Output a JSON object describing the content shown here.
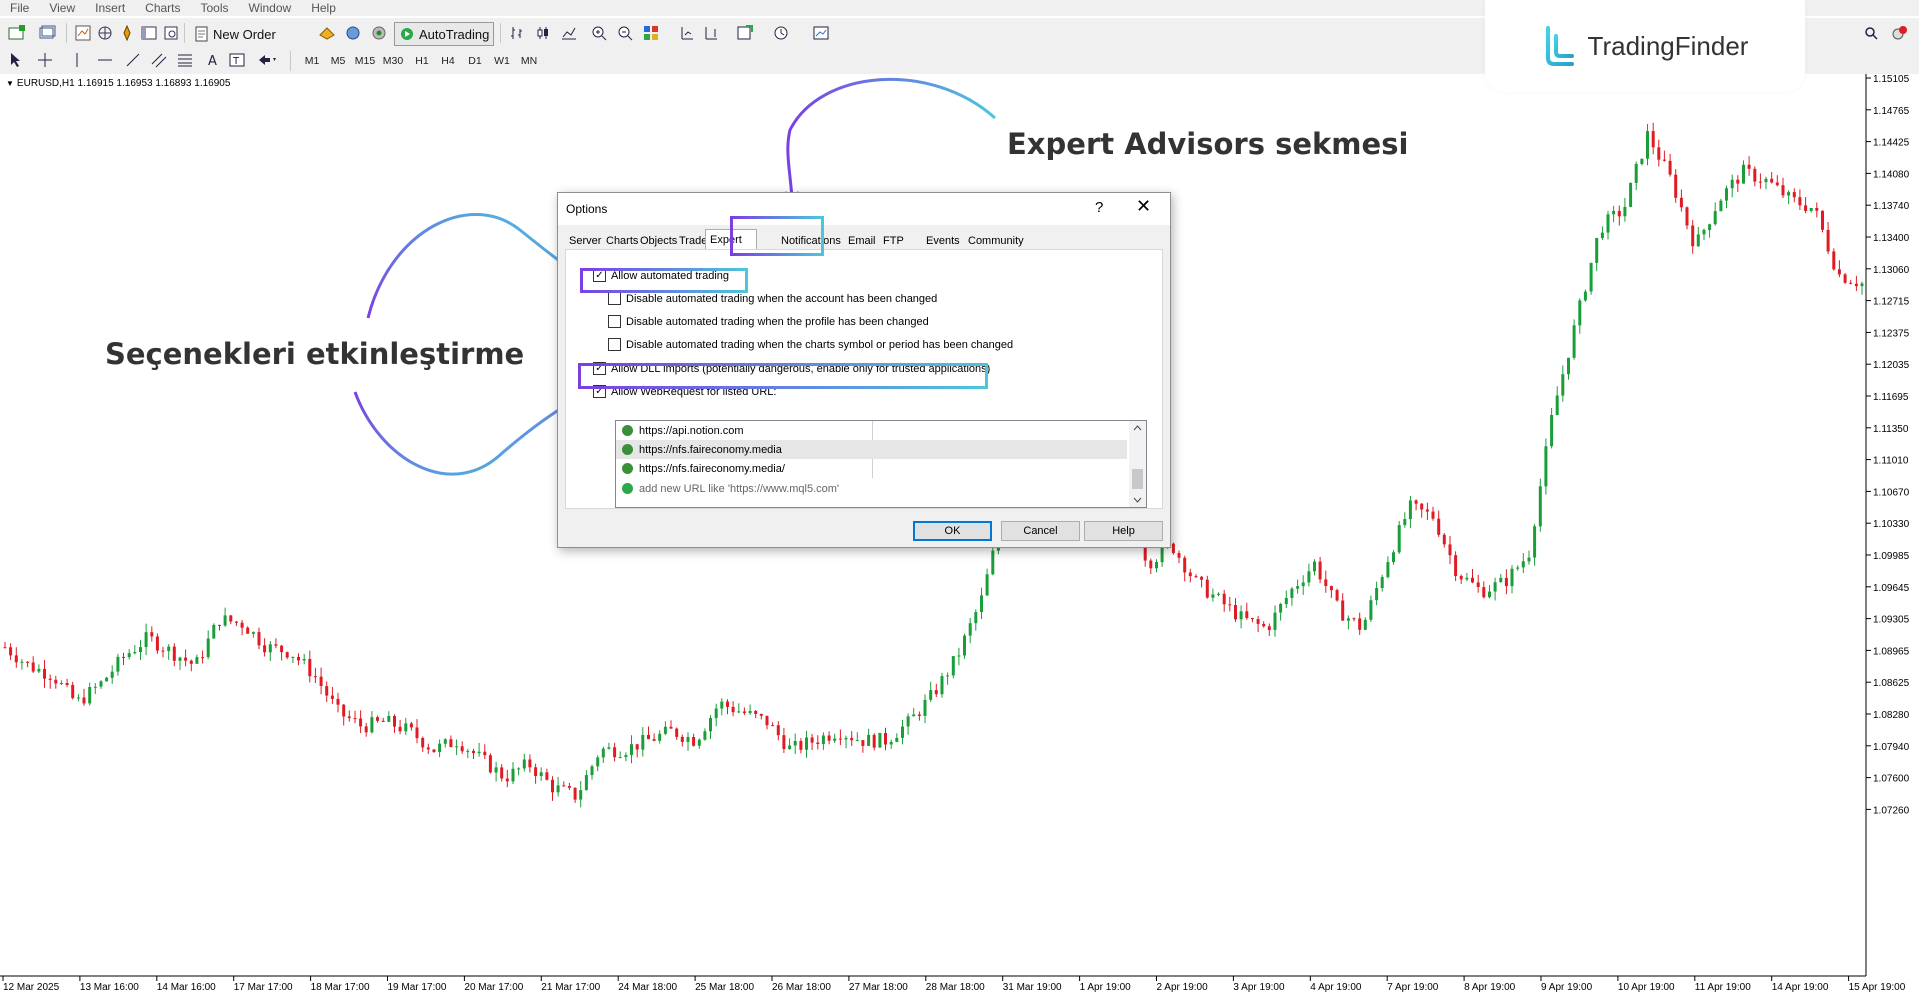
{
  "menu": [
    "File",
    "View",
    "Insert",
    "Charts",
    "Tools",
    "Window",
    "Help"
  ],
  "toolbar": {
    "new_order_label": "New Order",
    "autotrading_label": "AutoTrading",
    "timeframes": [
      "M1",
      "M5",
      "M15",
      "M30",
      "H1",
      "H4",
      "D1",
      "W1",
      "MN"
    ]
  },
  "logo": {
    "brand": "TradingFinder"
  },
  "chart": {
    "info": "EURUSD,H1  1.16915 1.16953 1.16893 1.16905",
    "price_labels": [
      "1.15105",
      "1.14765",
      "1.14425",
      "1.14080",
      "1.13740",
      "1.13400",
      "1.13060",
      "1.12715",
      "1.12375",
      "1.12035",
      "1.11695",
      "1.11350",
      "1.11010",
      "1.10670",
      "1.10330",
      "1.09985",
      "1.09645",
      "1.09305",
      "1.08965",
      "1.08625",
      "1.08280",
      "1.07940",
      "1.07600",
      "1.07260"
    ],
    "date_labels": [
      "12 Mar 2025",
      "13 Mar 16:00",
      "14 Mar 16:00",
      "17 Mar 17:00",
      "18 Mar 17:00",
      "19 Mar 17:00",
      "20 Mar 17:00",
      "21 Mar 17:00",
      "24 Mar 18:00",
      "25 Mar 18:00",
      "26 Mar 18:00",
      "27 Mar 18:00",
      "28 Mar 18:00",
      "31 Mar 19:00",
      "1 Apr 19:00",
      "2 Apr 19:00",
      "3 Apr 19:00",
      "4 Apr 19:00",
      "7 Apr 19:00",
      "8 Apr 19:00",
      "9 Apr 19:00",
      "10 Apr 19:00",
      "11 Apr 19:00",
      "14 Apr 19:00",
      "15 Apr 19:00"
    ],
    "colors": {
      "bull": "#1a9e3a",
      "bear": "#e01b24",
      "grid": "#cccccc"
    }
  },
  "annotations": {
    "tab_caption": "Expert Advisors sekmesi",
    "options_caption": "Seçenekleri etkinleştirme",
    "colors": {
      "purple": "#7b3fe4",
      "cyan": "#4cc6dc"
    }
  },
  "dialog": {
    "title": "Options",
    "help_glyph": "?",
    "close_glyph": "✕",
    "tabs": [
      "Server",
      "Charts",
      "Objects",
      "Trade",
      "Expert Advisors",
      "Notifications",
      "Email",
      "FTP",
      "Events",
      "Community"
    ],
    "active_tab": "Expert Advisors",
    "options": [
      {
        "label": "Allow automated trading",
        "checked": true
      },
      {
        "label": "Disable automated trading when the account has been changed",
        "checked": false
      },
      {
        "label": "Disable automated trading when the profile has been changed",
        "checked": false
      },
      {
        "label": "Disable automated trading when the charts symbol or period has been changed",
        "checked": false
      },
      {
        "label": "Allow DLL imports (potentially dangerous, enable only for trusted applications)",
        "checked": true
      },
      {
        "label": "Allow WebRequest for listed URL:",
        "checked": true
      }
    ],
    "urls": [
      "https://api.notion.com",
      "https://nfs.faireconomy.media",
      "https://nfs.faireconomy.media/"
    ],
    "add_url_hint": "add new URL like 'https://www.mql5.com'",
    "buttons": {
      "ok": "OK",
      "cancel": "Cancel",
      "help": "Help"
    }
  }
}
